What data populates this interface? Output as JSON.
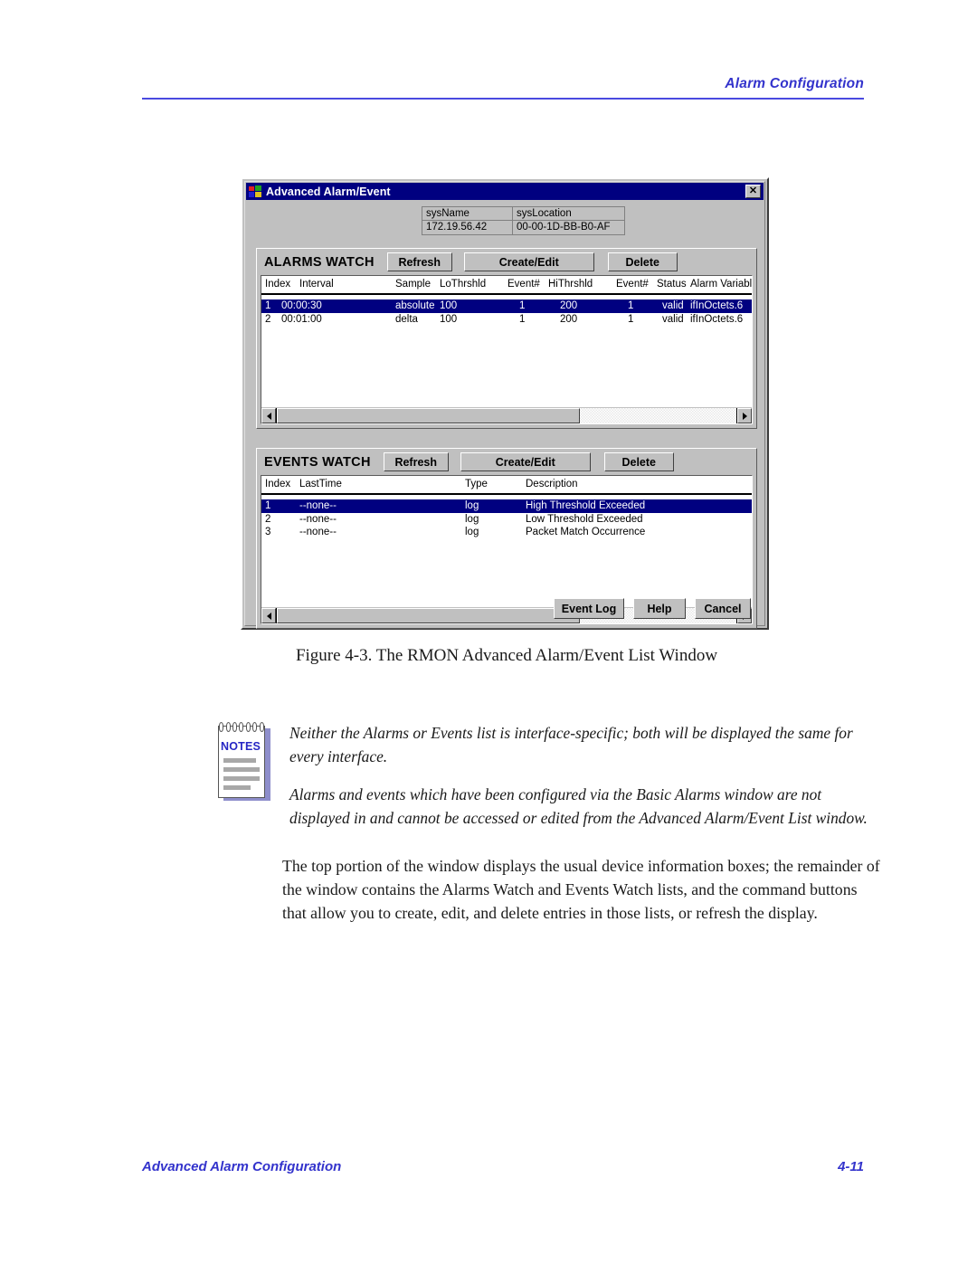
{
  "page": {
    "header_title": "Alarm Configuration",
    "footer_left": "Advanced Alarm Configuration",
    "footer_right": "4-11",
    "figure_caption": "Figure 4-3.  The RMON Advanced Alarm/Event List Window",
    "accent_color": "#3333cc",
    "rule_color": "#4a4ae0"
  },
  "window": {
    "title": "Advanced Alarm/Event",
    "close_label": "✕",
    "titlebar_color": "#000080",
    "face_color": "#c0c0c0",
    "sysinfo": {
      "name_header": "sysName",
      "name_value": "172.19.56.42",
      "location_header": "sysLocation",
      "location_value": "00-00-1D-BB-B0-AF"
    },
    "alarms": {
      "title": "ALARMS WATCH",
      "buttons": {
        "refresh": "Refresh",
        "create_edit": "Create/Edit",
        "delete": "Delete"
      },
      "columns": [
        "Index",
        "Interval",
        "Sample",
        "LoThrshld",
        "Event#",
        "HiThrshld",
        "Event#",
        "Status",
        "Alarm Variable"
      ],
      "rows": [
        {
          "index": "1",
          "interval": "00:00:30",
          "sample": "absolute",
          "lothrshld": "100",
          "event_lo": "1",
          "hithrshld": "200",
          "event_hi": "1",
          "status": "valid",
          "variable": "ifInOctets.6",
          "selected": true
        },
        {
          "index": "2",
          "interval": "00:01:00",
          "sample": "delta",
          "lothrshld": "100",
          "event_lo": "1",
          "hithrshld": "200",
          "event_hi": "1",
          "status": "valid",
          "variable": "ifInOctets.6",
          "selected": false
        }
      ],
      "scrollbar": {
        "left_arrow": "◄",
        "right_arrow": "►",
        "thumb_fraction": 0.66
      }
    },
    "events": {
      "title": "EVENTS WATCH",
      "buttons": {
        "refresh": "Refresh",
        "create_edit": "Create/Edit",
        "delete": "Delete"
      },
      "columns": [
        "Index",
        "LastTime",
        "Type",
        "Description"
      ],
      "rows": [
        {
          "index": "1",
          "lasttime": "--none--",
          "type": "log",
          "description": "High Threshold Exceeded",
          "selected": true
        },
        {
          "index": "2",
          "lasttime": "--none--",
          "type": "log",
          "description": "Low Threshold Exceeded",
          "selected": false
        },
        {
          "index": "3",
          "lasttime": "--none--",
          "type": "log",
          "description": "Packet Match Occurrence",
          "selected": false
        }
      ],
      "scrollbar": {
        "left_arrow": "◄",
        "right_arrow": "►",
        "thumb_fraction": 0.66
      }
    },
    "commands": {
      "event_log": "Event Log",
      "help": "Help",
      "cancel": "Cancel"
    }
  },
  "notes": {
    "label": "NOTES",
    "paragraphs": [
      "Neither the Alarms or Events list is interface-specific; both will be displayed the same for every interface.",
      "Alarms and events which have been configured via the Basic Alarms window are not displayed in and cannot be accessed or edited from the Advanced Alarm/Event List window."
    ]
  },
  "body": {
    "paragraph": "The top portion of the window displays the usual device information boxes; the remainder of the window contains the Alarms Watch and Events Watch lists, and the command buttons that allow you to create, edit, and delete entries in those lists, or refresh the display."
  }
}
